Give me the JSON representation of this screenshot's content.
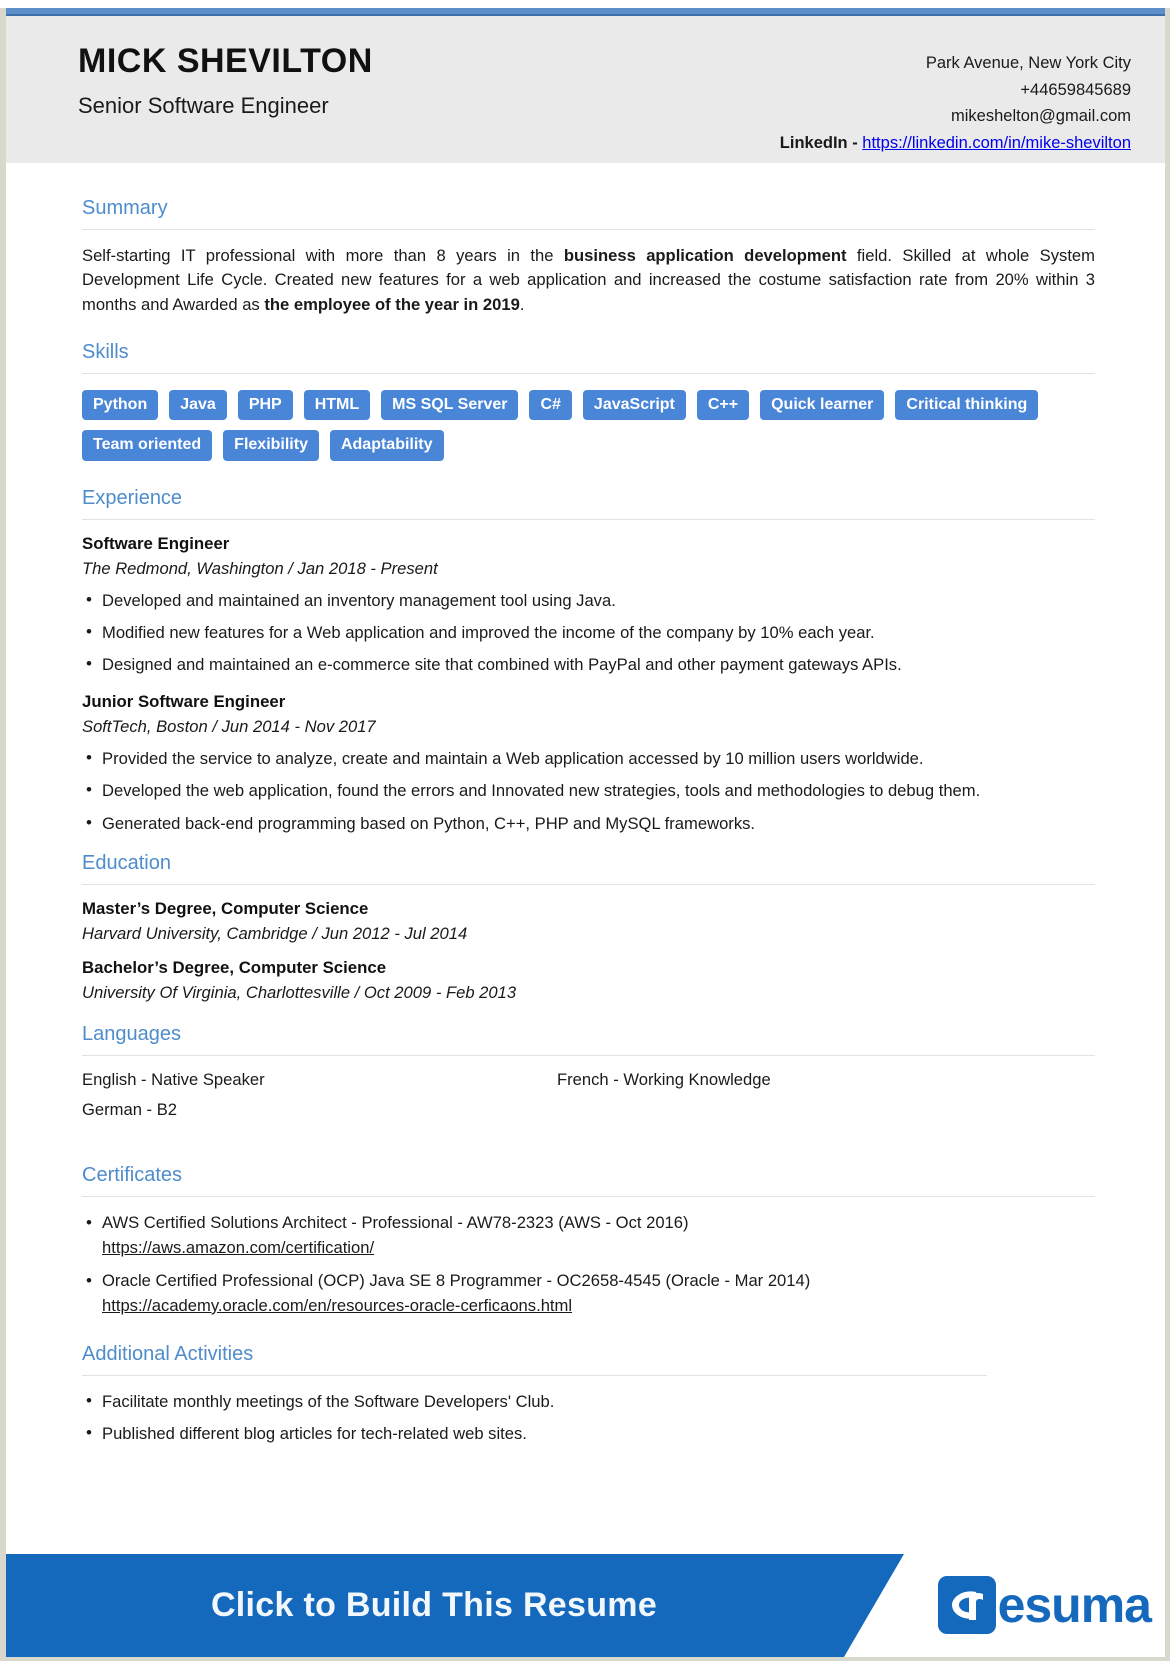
{
  "theme": {
    "accent_blue": "#4e8ccc",
    "tag_blue": "#4a86d8",
    "banner_blue": "#1569bd",
    "header_bg": "#eaeaea"
  },
  "header": {
    "name": "MICK SHEVILTON",
    "job_title": "Senior Software Engineer",
    "address": "Park Avenue, New York City",
    "phone": "+44659845689",
    "email": "mikeshelton@gmail.com",
    "linkedin_label": "LinkedIn - ",
    "linkedin_url": "https://linkedin.com/in/mike-shevilton"
  },
  "sections": {
    "summary": {
      "heading": "Summary",
      "text_1": "Self-starting IT professional with more than 8 years in the ",
      "bold_1": "business application development",
      "text_2": " field. Skilled at whole System Development Life Cycle. Created new features for a web application and increased the costume satisfaction rate from 20% within 3 months and Awarded as ",
      "bold_2": "the employee of the year in 2019",
      "text_3": "."
    },
    "skills": {
      "heading": "Skills",
      "items": [
        "Python",
        "Java",
        "PHP",
        "HTML",
        "MS SQL Server",
        "C#",
        "JavaScript",
        "C++",
        "Quick learner",
        "Critical thinking",
        "Team oriented",
        "Flexibility",
        "Adaptability"
      ]
    },
    "experience": {
      "heading": "Experience",
      "entries": [
        {
          "title": "Software Engineer",
          "subtitle": "The Redmond, Washington / Jan 2018 - Present",
          "bullets": [
            "Developed and maintained an inventory management tool using Java.",
            "Modified new features for a Web application and improved the income of the company by 10% each year.",
            "Designed and maintained an e-commerce site that combined with PayPal and other payment gateways APIs."
          ]
        },
        {
          "title": "Junior Software Engineer",
          "subtitle": "SoftTech, Boston / Jun 2014 - Nov 2017",
          "bullets": [
            "Provided the service to analyze, create and maintain a Web application accessed by 10 million users worldwide.",
            "Developed the web application, found the errors and Innovated new strategies, tools and methodologies to debug them.",
            "Generated back-end programming based on Python, C++, PHP and MySQL frameworks."
          ]
        }
      ]
    },
    "education": {
      "heading": "Education",
      "entries": [
        {
          "title": "Master’s Degree, Computer Science",
          "subtitle": "Harvard University, Cambridge / Jun 2012 - Jul 2014"
        },
        {
          "title": "Bachelor’s Degree, Computer Science",
          "subtitle": "University Of Virginia, Charlottesville / Oct 2009 - Feb 2013"
        }
      ]
    },
    "languages": {
      "heading": "Languages",
      "items": [
        "English - Native Speaker",
        "French - Working Knowledge",
        "German - B2"
      ]
    },
    "certificates": {
      "heading": "Certificates",
      "items": [
        {
          "title": "AWS Certified Solutions Architect - Professional - AW78-2323  (AWS  -  Oct 2016)",
          "url": "https://aws.amazon.com/certification/"
        },
        {
          "title": "Oracle Certified Professional (OCP) Java SE 8 Programmer - OC2658-4545  (Oracle  -  Mar 2014)",
          "url": "https://academy.oracle.com/en/resources-oracle-cerficaons.html"
        }
      ]
    },
    "additional_activities": {
      "heading": "Additional Activities",
      "bullets": [
        "Facilitate monthly meetings of the Software Developers' Club.",
        "Published different blog articles for tech-related web sites."
      ]
    }
  },
  "footer": {
    "cta_text": "Click to Build This Resume",
    "brand_mark": "CR",
    "brand_word": "esuma"
  }
}
